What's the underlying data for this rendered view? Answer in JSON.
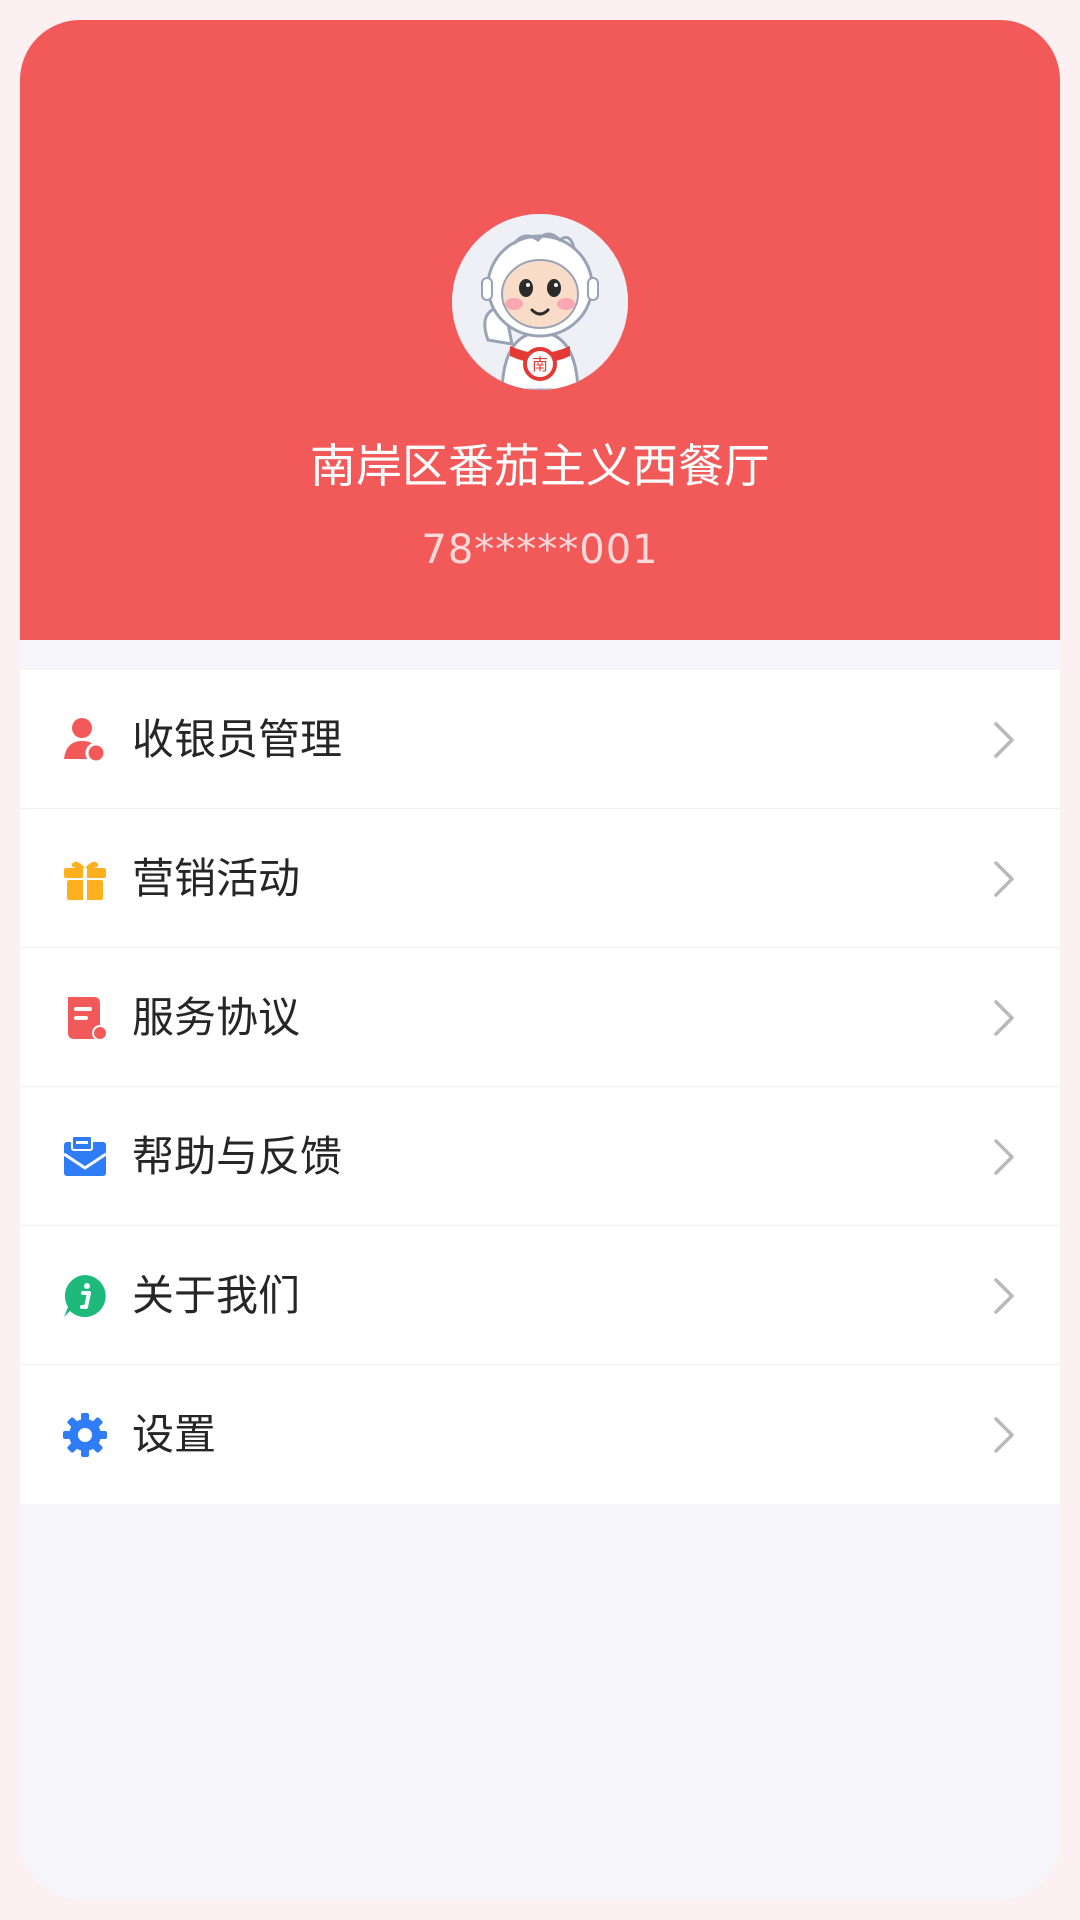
{
  "profile": {
    "store_name": "南岸区番茄主义西餐厅",
    "account": "78*****001",
    "avatar_icon": "mascot-avatar-icon"
  },
  "menu": {
    "items": [
      {
        "label": "收银员管理",
        "icon": "cashier-user-icon",
        "color": "#f25a5a"
      },
      {
        "label": "营销活动",
        "icon": "gift-icon",
        "color": "#ffb01f"
      },
      {
        "label": "服务协议",
        "icon": "agreement-doc-icon",
        "color": "#f25a5a"
      },
      {
        "label": "帮助与反馈",
        "icon": "mail-feedback-icon",
        "color": "#2e7cf6"
      },
      {
        "label": "关于我们",
        "icon": "info-icon",
        "color": "#1dba7b"
      },
      {
        "label": "设置",
        "icon": "gear-icon",
        "color": "#2e7cf6"
      }
    ],
    "chevron_icon": "chevron-right-icon"
  },
  "colors": {
    "header": "#f25a5a",
    "background": "#f6f5fa",
    "outer_border": "#fdf0f2"
  }
}
